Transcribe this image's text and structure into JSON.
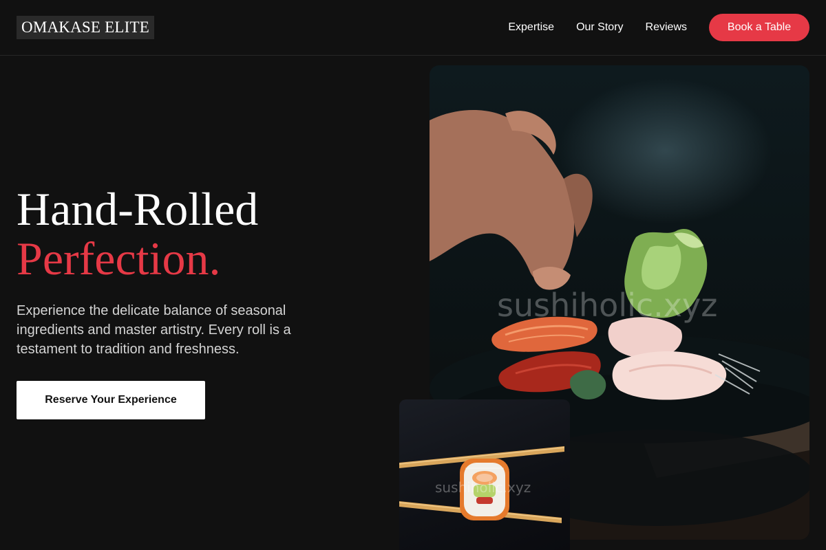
{
  "header": {
    "logo": "OMAKASE ELITE",
    "nav": [
      {
        "label": "Expertise"
      },
      {
        "label": "Our Story"
      },
      {
        "label": "Reviews"
      }
    ],
    "cta_label": "Book a Table"
  },
  "hero": {
    "title_line1": "Hand-Rolled",
    "title_line2": "Perfection.",
    "description": "Experience the delicate balance of seasonal ingredients and master artistry. Every roll is a testament to tradition and freshness.",
    "button_label": "Reserve Your Experience"
  },
  "images": {
    "main_watermark": "sushiholic.xyz",
    "small_watermark": "sushiholic.xyz"
  },
  "colors": {
    "accent": "#e63946",
    "background": "#111111"
  }
}
